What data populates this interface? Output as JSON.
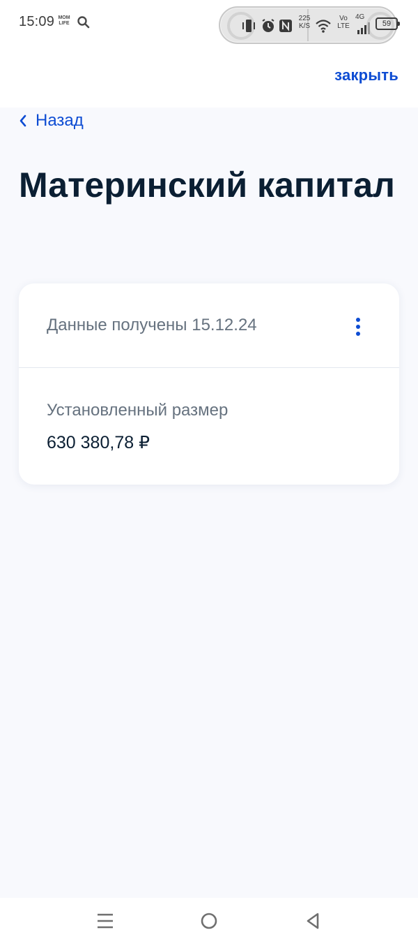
{
  "status_bar": {
    "time": "15:09",
    "app_badge": "MOM LIFE",
    "net_speed_value": "225",
    "net_speed_unit": "K/S",
    "volte_top": "Vo",
    "volte_bottom": "LTE",
    "network_type": "4G",
    "battery_level": "59"
  },
  "header": {
    "close_label": "закрыть"
  },
  "back": {
    "label": "Назад"
  },
  "page": {
    "title": "Материнский капитал"
  },
  "card": {
    "date_text": "Данные получены 15.12.24",
    "label": "Установленный размер",
    "amount": "630 380,78 ₽"
  },
  "colors": {
    "accent": "#0d4cd3",
    "text_primary": "#0b1f33",
    "text_secondary": "#66727f",
    "background": "#f8f9fd"
  }
}
